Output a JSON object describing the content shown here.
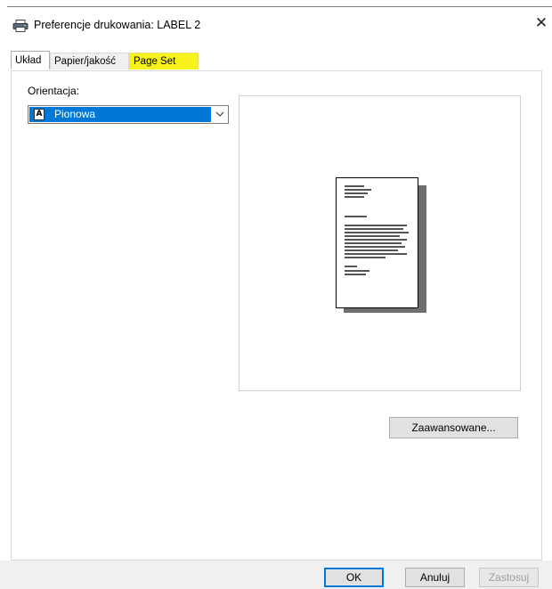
{
  "window": {
    "title": "Preferencje drukowania: LABEL 2",
    "close_label": "✕",
    "icon": "printer-icon"
  },
  "tabs": [
    {
      "label": "Układ",
      "active": true
    },
    {
      "label": "Papier/jakość",
      "active": false
    },
    {
      "label": "Page Set",
      "active": false,
      "highlighted": true,
      "highlight_color": "#f7f21b"
    }
  ],
  "layout": {
    "orientation_label": "Orientacja:",
    "orientation_value": "Pionowa",
    "orientation_icon": "portrait-page-icon",
    "advanced_button": "Zaawansowane..."
  },
  "footer": {
    "ok": "OK",
    "cancel": "Anuluj",
    "apply": "Zastosuj",
    "apply_enabled": false
  },
  "colors": {
    "selection": "#0078d7",
    "highlight": "#f7f21b"
  }
}
